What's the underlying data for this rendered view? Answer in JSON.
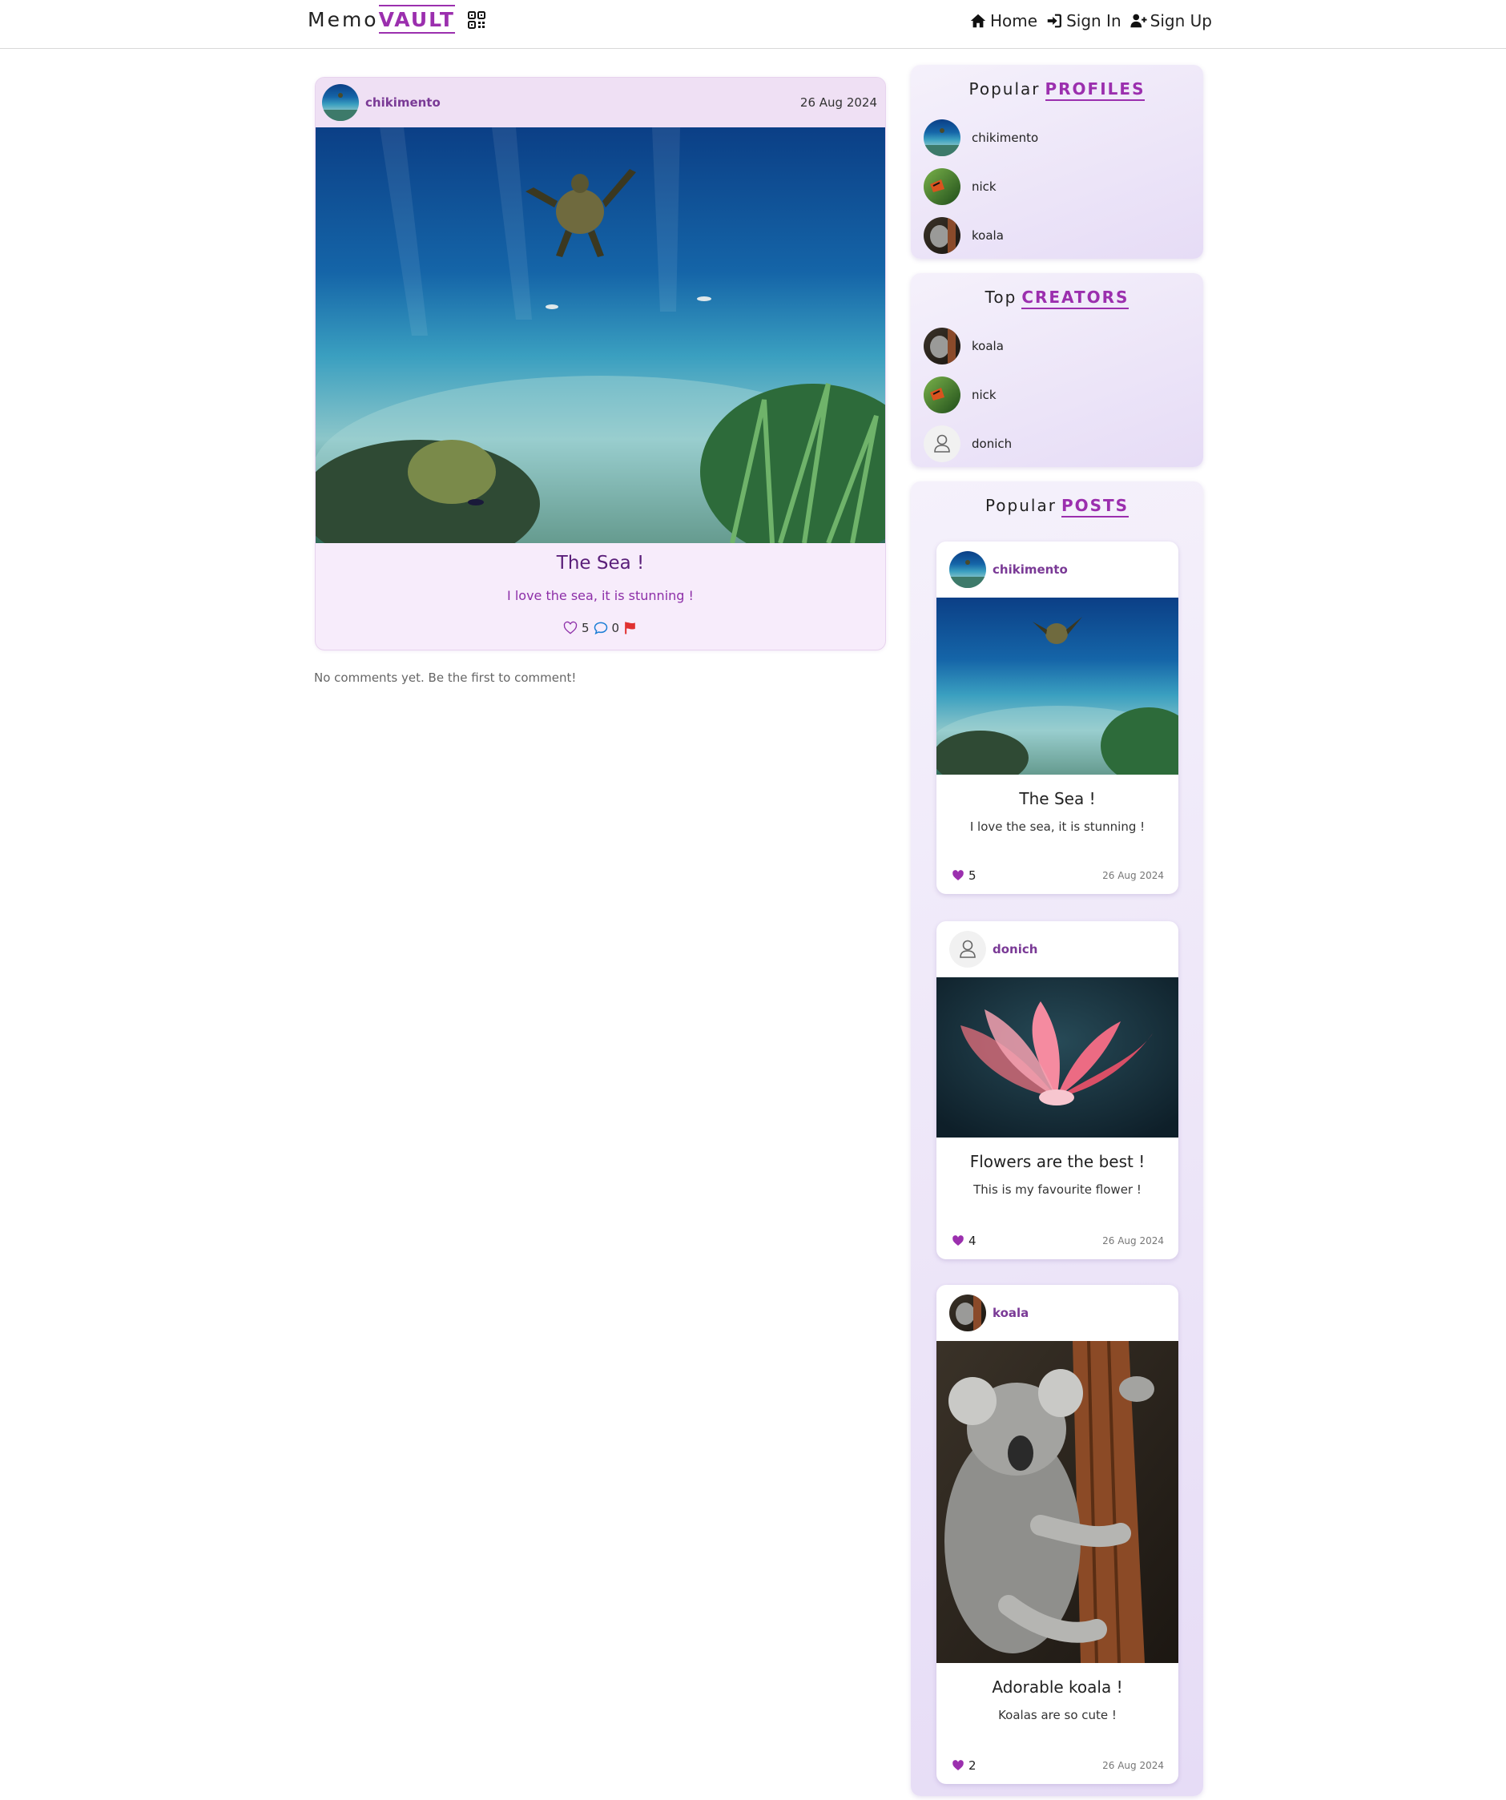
{
  "nav": {
    "brand_memo": "Memo",
    "brand_vault": "VAULT",
    "brand_icon": "qr-code-icon",
    "links": [
      {
        "label": "Home",
        "icon": "home-icon"
      },
      {
        "label": "Sign In",
        "icon": "sign-in-icon"
      },
      {
        "label": "Sign Up",
        "icon": "user-plus-icon"
      }
    ]
  },
  "post": {
    "author": "chikimento",
    "date": "26 Aug 2024",
    "title": "The Sea !",
    "description": "I love the sea, it is stunning !",
    "likes": "5",
    "comments": "0",
    "icons": [
      "heart-outline-icon",
      "comment-icon",
      "flag-icon"
    ]
  },
  "comments": {
    "empty_text": "No comments yet. Be the first to comment!"
  },
  "popular_profiles": {
    "title_plain": "Popular",
    "title_accent": "PROFILES",
    "items": [
      {
        "name": "chikimento"
      },
      {
        "name": "nick"
      },
      {
        "name": "koala"
      }
    ]
  },
  "top_creators": {
    "title_plain": "Top",
    "title_accent": "CREATORS",
    "items": [
      {
        "name": "koala"
      },
      {
        "name": "nick"
      },
      {
        "name": "donich"
      }
    ]
  },
  "popular_posts": {
    "title_plain": "Popular",
    "title_accent": "POSTS",
    "items": [
      {
        "author": "chikimento",
        "title": "The Sea !",
        "description": "I love the sea, it is stunning !",
        "likes": "5",
        "date": "26 Aug 2024"
      },
      {
        "author": "donich",
        "title": "Flowers are the best !",
        "description": "This is my favourite flower !",
        "likes": "4",
        "date": "26 Aug 2024"
      },
      {
        "author": "koala",
        "title": "Adorable koala !",
        "description": "Koalas are so cute !",
        "likes": "2",
        "date": "26 Aug 2024"
      }
    ]
  },
  "colors": {
    "accent": "#9b2fae",
    "author": "#7a3a96",
    "flag": "#e03131",
    "comment": "#1c7ed6"
  }
}
